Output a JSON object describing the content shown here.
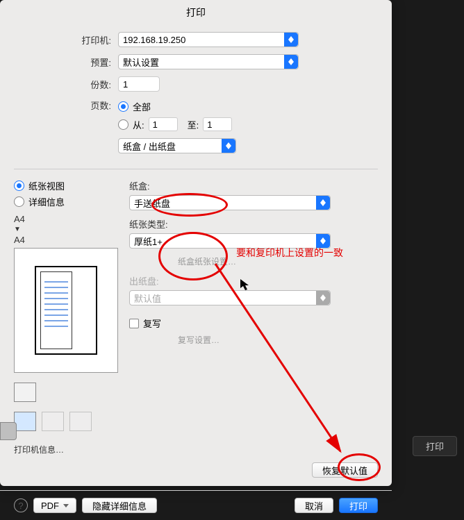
{
  "title": "打印",
  "form": {
    "printer_label": "打印机:",
    "printer_value": "192.168.19.250",
    "preset_label": "预置:",
    "preset_value": "默认设置",
    "copies_label": "份数:",
    "copies_value": "1",
    "pages_label": "页数:",
    "pages_all": "全部",
    "pages_from": "从:",
    "pages_from_val": "1",
    "pages_to": "至:",
    "pages_to_val": "1",
    "section_select": "纸盒 / 出纸盘"
  },
  "left": {
    "view_paper": "纸张视图",
    "view_detail": "详细信息",
    "a4_1": "A4",
    "a4_2": "A4",
    "printer_info": "打印机信息…"
  },
  "right": {
    "tray_label": "纸盒:",
    "tray_value": "手送纸盘",
    "paper_type_label": "纸张类型:",
    "paper_type_value": "厚纸1+",
    "tray_paper_settings": "纸盒纸张设置…",
    "output_label": "出纸盘:",
    "output_value": "默认值",
    "copy_check": "复写",
    "copy_settings": "复写设置…",
    "restore": "恢复默认值"
  },
  "footer": {
    "help": "?",
    "pdf": "PDF",
    "hide": "隐藏详细信息",
    "cancel": "取消",
    "print": "打印"
  },
  "annotation": {
    "note": "要和复印机上设置的一致"
  },
  "underlying": {
    "print": "打印"
  }
}
